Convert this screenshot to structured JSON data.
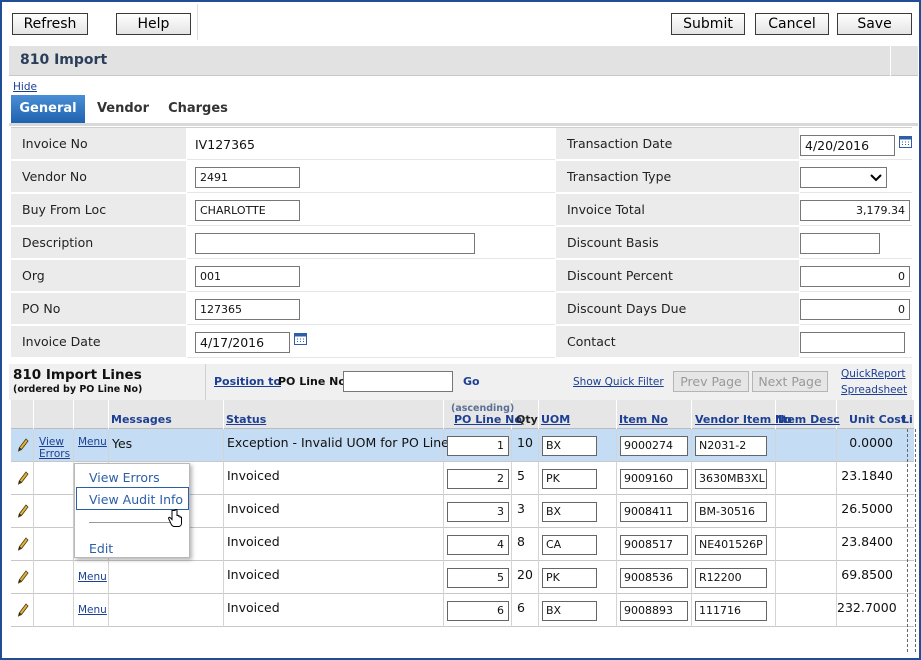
{
  "toolbar": {
    "refresh_label": "Refresh",
    "help_label": "Help",
    "submit_label": "Submit",
    "cancel_label": "Cancel",
    "save_label": "Save"
  },
  "header": {
    "title": "810 Import"
  },
  "hide_label": "Hide",
  "tabs": [
    {
      "label": "General",
      "active": true
    },
    {
      "label": "Vendor",
      "active": false
    },
    {
      "label": "Charges",
      "active": false
    }
  ],
  "form": {
    "left": [
      {
        "label": "Invoice No",
        "value": "IV127365",
        "kind": "text"
      },
      {
        "label": "Vendor No",
        "value": "2491",
        "kind": "input"
      },
      {
        "label": "Buy From Loc",
        "value": "CHARLOTTE",
        "kind": "input"
      },
      {
        "label": "Description",
        "value": "",
        "kind": "input"
      },
      {
        "label": "Org",
        "value": "001",
        "kind": "input"
      },
      {
        "label": "PO No",
        "value": "127365",
        "kind": "input"
      },
      {
        "label": "Invoice Date",
        "value": "4/17/2016",
        "kind": "date"
      }
    ],
    "right": [
      {
        "label": "Transaction Date",
        "value": "4/20/2016",
        "kind": "date"
      },
      {
        "label": "Transaction Type",
        "value": "",
        "kind": "select"
      },
      {
        "label": "Invoice Total",
        "value": "3,179.34",
        "kind": "number"
      },
      {
        "label": "Discount Basis",
        "value": "",
        "kind": "input"
      },
      {
        "label": "Discount Percent",
        "value": "0",
        "kind": "number"
      },
      {
        "label": "Discount Days Due",
        "value": "0",
        "kind": "number"
      },
      {
        "label": "Contact",
        "value": "",
        "kind": "input"
      }
    ]
  },
  "lines": {
    "title": "810 Import Lines",
    "subtitle": "(ordered by PO Line No)",
    "position_to_label": "Position to",
    "position_field_label": "PO Line No",
    "position_value": "",
    "go_label": "Go",
    "show_quick_filter": "Show Quick Filter",
    "prev_page": "Prev Page",
    "next_page": "Next Page",
    "quick_report": "QuickReport",
    "spreadsheet": "Spreadsheet",
    "sort_note": "(ascending)",
    "columns": {
      "messages": "Messages",
      "status": "Status",
      "po_line_no": "PO Line No",
      "qty": "Qty",
      "uom": "UOM",
      "item_no": "Item No",
      "vendor_item_no": "Vendor Item No",
      "item_desc": "Item Desc",
      "unit_cost": "Unit Cost",
      "li": "Li"
    },
    "view_errors_label": "View Errors",
    "view_label": "View",
    "errors_label": "Errors",
    "menu_label": "Menu",
    "rows": [
      {
        "messages": "Yes",
        "status": "Exception - Invalid UOM for PO Line",
        "po_line": "1",
        "qty": "10",
        "uom": "BX",
        "item_no": "9000274",
        "vendor_item": "N2031-2",
        "unit_cost": "0.0000"
      },
      {
        "messages": "",
        "status": "Invoiced",
        "po_line": "2",
        "qty": "5",
        "uom": "PK",
        "item_no": "9009160",
        "vendor_item": "3630MB3XL",
        "unit_cost": "23.1840"
      },
      {
        "messages": "",
        "status": "Invoiced",
        "po_line": "3",
        "qty": "3",
        "uom": "BX",
        "item_no": "9008411",
        "vendor_item": "BM-30516",
        "unit_cost": "26.5000"
      },
      {
        "messages": "",
        "status": "Invoiced",
        "po_line": "4",
        "qty": "8",
        "uom": "CA",
        "item_no": "9008517",
        "vendor_item": "NE401526P",
        "unit_cost": "23.8400"
      },
      {
        "messages": "",
        "status": "Invoiced",
        "po_line": "5",
        "qty": "20",
        "uom": "PK",
        "item_no": "9008536",
        "vendor_item": "R12200",
        "unit_cost": "69.8500"
      },
      {
        "messages": "",
        "status": "Invoiced",
        "po_line": "6",
        "qty": "6",
        "uom": "BX",
        "item_no": "9008893",
        "vendor_item": "111716",
        "unit_cost": "232.7000"
      }
    ]
  },
  "context_menu": {
    "items": [
      "View Errors",
      "View Audit Info",
      "Edit"
    ]
  }
}
